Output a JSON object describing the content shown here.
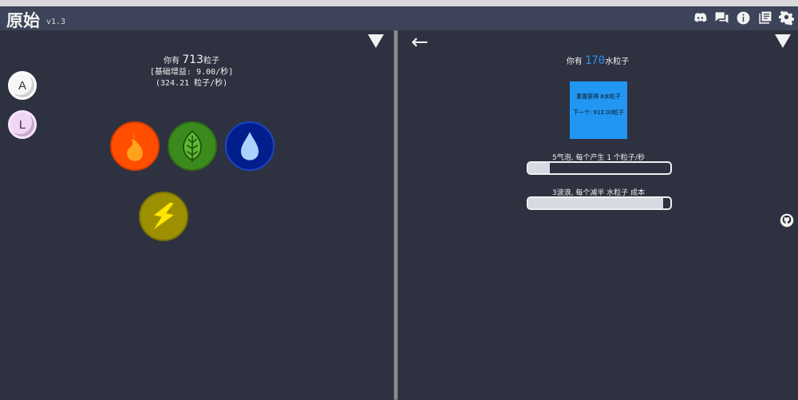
{
  "header": {
    "title": "原始",
    "version": "v1.3",
    "icons": [
      "discord-icon",
      "chat-icon",
      "info-icon",
      "changelog-icon",
      "settings-icon"
    ]
  },
  "left": {
    "you_have": "你有",
    "particles": "713",
    "particles_unit": "粒子",
    "base_gain": "[基础增益: 9.00/秒]",
    "rate": "(324.21 粒子/秒)",
    "side_buttons": [
      "A",
      "L"
    ],
    "elements": [
      "fire",
      "leaf",
      "water",
      "thunder"
    ]
  },
  "right": {
    "back": "←",
    "you_have": "你有",
    "water_particles": "170",
    "water_unit": "水粒子",
    "reset_line1": "重置获得 8水粒子",
    "reset_line2": "下一个: 912.00粒子",
    "upgrades": [
      {
        "label": "5气泡, 每个产生 1 个粒子/秒",
        "progress": 0.15
      },
      {
        "label": "3波浪, 每个减半 水粒子 成本",
        "progress": 0.95
      }
    ]
  },
  "colors": {
    "background": "#2e3240",
    "header": "#3d4358",
    "accent_blue": "#2196f3",
    "fire": "#ff4e00",
    "leaf": "#3b8a1e",
    "water": "#001f8c",
    "thunder": "#9c9000"
  }
}
